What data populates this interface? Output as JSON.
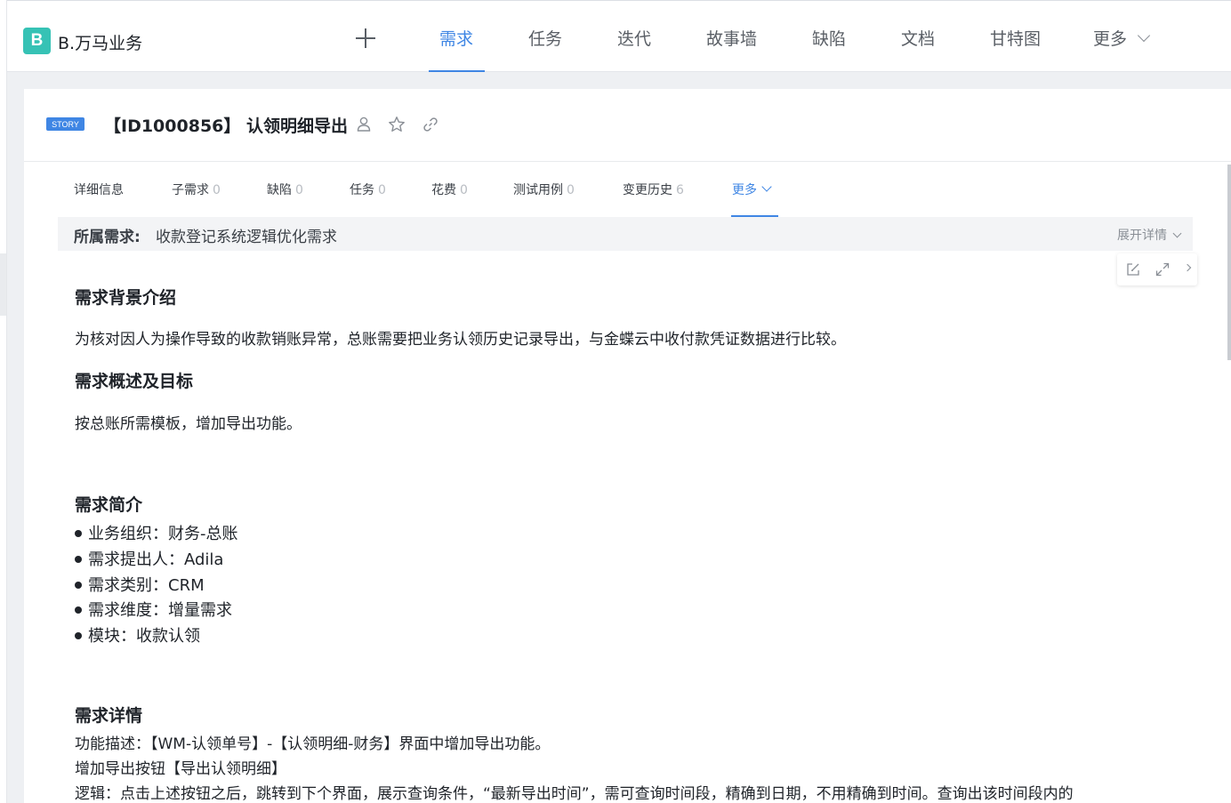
{
  "project": {
    "logo_letter": "B",
    "name": "B.万马业务"
  },
  "nav": {
    "tabs": [
      {
        "label": "需求",
        "active": true
      },
      {
        "label": "任务"
      },
      {
        "label": "迭代"
      },
      {
        "label": "故事墙"
      },
      {
        "label": "缺陷"
      },
      {
        "label": "文档"
      },
      {
        "label": "甘特图"
      },
      {
        "label": "更多"
      }
    ]
  },
  "story": {
    "badge": "STORY",
    "title": "【ID1000856】 认领明细导出"
  },
  "subtabs": [
    {
      "label": "详细信息",
      "count": ""
    },
    {
      "label": "子需求",
      "count": "0"
    },
    {
      "label": "缺陷",
      "count": "0"
    },
    {
      "label": "任务",
      "count": "0"
    },
    {
      "label": "花费",
      "count": "0"
    },
    {
      "label": "测试用例",
      "count": "0"
    },
    {
      "label": "变更历史",
      "count": "6"
    },
    {
      "label": "更多",
      "count": ""
    }
  ],
  "parent": {
    "label": "所属需求:",
    "value": "收款登记系统逻辑优化需求",
    "expand_label": "展开详情"
  },
  "doc": {
    "background_heading": "需求背景介绍",
    "background_text": "为核对因人为操作导致的收款销账异常，总账需要把业务认领历史记录导出，与金蝶云中收付款凭证数据进行比较。",
    "overview_heading": "需求概述及目标",
    "overview_text": "按总账所需模板，增加导出功能。",
    "brief_heading": "需求简介",
    "brief_items": [
      "业务组织：财务-总账",
      "需求提出人：Adila",
      "需求类别：CRM",
      "需求维度：增量需求",
      "模块：收款认领"
    ],
    "detail_heading": "需求详情",
    "detail_lines": [
      "功能描述：【WM-认领单号】-【认领明细-财务】界面中增加导出功能。",
      "增加导出按钮【导出认领明细】",
      "逻辑：点击上述按钮之后，跳转到下个界面，展示查询条件，“最新导出时间”，需可查询时间段，精确到日期，不用精确到时间。查询出该时间段内的"
    ]
  },
  "colors": {
    "accent": "#3f86e4",
    "logo": "#36c2b5"
  }
}
